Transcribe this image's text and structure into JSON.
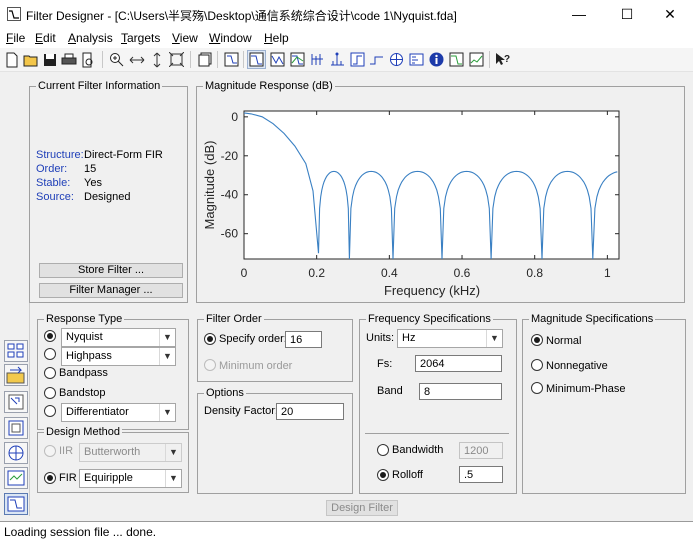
{
  "window": {
    "title": "Filter Designer - [C:\\Users\\半冥殇\\Desktop\\通信系统综合设计\\code 1\\Nyquist.fda]",
    "minimize_glyph": "—",
    "maximize_glyph": "☐",
    "close_glyph": "✕"
  },
  "menu": {
    "items": [
      {
        "key": "F",
        "rest": "ile"
      },
      {
        "key": "E",
        "rest": "dit"
      },
      {
        "key": "A",
        "rest": "nalysis"
      },
      {
        "key": "T",
        "rest": "argets"
      },
      {
        "key": "V",
        "rest": "iew"
      },
      {
        "key": "W",
        "rest": "indow"
      },
      {
        "key": "H",
        "rest": "elp"
      }
    ]
  },
  "toolbar": {
    "icons": [
      "new-icon",
      "open-icon",
      "save-icon",
      "print-icon",
      "print-preview-icon",
      "zoom-in-icon",
      "zoom-x-icon",
      "zoom-y-icon",
      "full-view-icon",
      "new-figure-icon",
      "design-filter-icon",
      "magnitude-response-icon",
      "phase-response-icon",
      "magnitude-phase-icon",
      "group-delay-icon",
      "impulse-response-icon",
      "step-response-icon",
      "pole-zero-icon",
      "filter-coefficients-icon",
      "filter-info-icon",
      "magnitude-estimate-icon",
      "round-off-noise-icon",
      "whats-this-icon"
    ]
  },
  "current_filter": {
    "panel_title": "Current Filter Information",
    "rows": [
      {
        "label": "Structure:",
        "value": "Direct-Form FIR"
      },
      {
        "label": "Order:",
        "value": "15"
      },
      {
        "label": "Stable:",
        "value": "Yes"
      },
      {
        "label": "Source:",
        "value": "Designed"
      }
    ],
    "store_button": "Store Filter ...",
    "manager_button": "Filter Manager ..."
  },
  "magnitude_response": {
    "panel_title": "Magnitude Response (dB)"
  },
  "chart_data": {
    "type": "line",
    "title": "",
    "xlabel": "Frequency (kHz)",
    "ylabel": "Magnitude (dB)",
    "xlim": [
      0,
      1.032
    ],
    "ylim": [
      -73,
      3
    ],
    "xticks": [
      0,
      0.2,
      0.4,
      0.6,
      0.8,
      1
    ],
    "yticks": [
      0,
      -20,
      -40,
      -60
    ],
    "grid": false,
    "color": "#3a80c3",
    "nulls_khz": [
      0.205,
      0.29,
      0.41,
      0.545,
      0.68,
      0.82,
      0.96
    ],
    "lobe_peaks_db": [
      -28,
      -28,
      -28,
      -28,
      -28,
      -28,
      -28
    ],
    "series": [
      {
        "x": [
          0,
          0.02,
          0.05,
          0.08,
          0.11,
          0.14,
          0.17,
          0.19,
          0.205
        ],
        "y": [
          2,
          1.5,
          0,
          -3.5,
          -8.5,
          -15,
          -24,
          -38,
          -70
        ]
      }
    ]
  },
  "response_type": {
    "panel_title": "Response Type",
    "options": [
      {
        "label": "Nyquist",
        "kind": "combo",
        "selected": true
      },
      {
        "label": "Highpass",
        "kind": "combo",
        "selected": false
      },
      {
        "label": "Bandpass",
        "kind": "text",
        "selected": false
      },
      {
        "label": "Bandstop",
        "kind": "text",
        "selected": false
      },
      {
        "label": "Differentiator",
        "kind": "combo",
        "selected": false
      }
    ]
  },
  "design_method": {
    "panel_title": "Design Method",
    "iir_label": "IIR",
    "iir_value": "Butterworth",
    "fir_label": "FIR",
    "fir_value": "Equiripple"
  },
  "filter_order": {
    "panel_title": "Filter Order",
    "specify_label": "Specify order:",
    "specify_value": "16",
    "minimum_label": "Minimum order"
  },
  "options": {
    "panel_title": "Options",
    "density_label": "Density Factor:",
    "density_value": "20"
  },
  "freq_specs": {
    "panel_title": "Frequency Specifications",
    "units_label": "Units:",
    "units_value": "Hz",
    "fs_label": "Fs:",
    "fs_value": "2064",
    "band_label": "Band",
    "band_value": "8",
    "bandwidth_label": "Bandwidth",
    "bandwidth_value": "1200",
    "rolloff_label": "Rolloff",
    "rolloff_value": ".5"
  },
  "mag_specs": {
    "panel_title": "Magnitude Specifications",
    "options": [
      "Normal",
      "Nonnegative",
      "Minimum-Phase"
    ]
  },
  "design_button": "Design Filter",
  "status": "Loading session file ... done."
}
